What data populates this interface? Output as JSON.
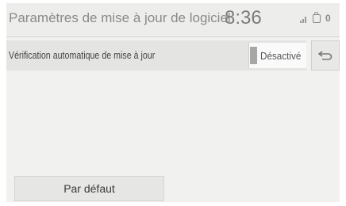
{
  "header": {
    "title": "Paramètres de mise à jour de logiciel",
    "time": "8:36",
    "status": {
      "signal_icon": "signal-icon",
      "bag_icon": "bag-icon",
      "count": "0"
    }
  },
  "settings": {
    "auto_update_label": "Vérification automatique de mise à jour",
    "auto_update_value": "Désactivé"
  },
  "buttons": {
    "back_icon": "back-arrow-icon",
    "default_label": "Par défaut"
  }
}
